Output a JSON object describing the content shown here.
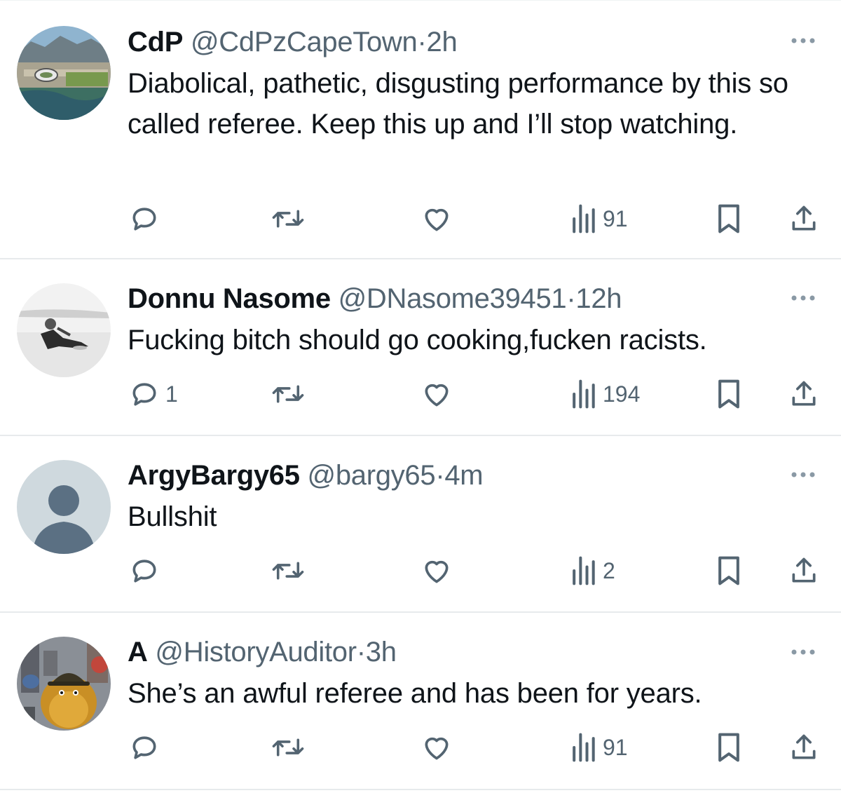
{
  "tweets": [
    {
      "name": "CdP",
      "handle": "@CdPzCapeTown",
      "separator": "·",
      "time": "2h",
      "text": "Diabolical, pathetic, disgusting performance by this so called referee. Keep this up and I’ll stop watching.",
      "reply_count": "",
      "views": "91"
    },
    {
      "name": "Donnu Nasome",
      "handle": "@DNasome39451",
      "separator": "·",
      "time": "12h",
      "text": "Fucking bitch should go cooking,fucken racists.",
      "reply_count": "1",
      "views": "194"
    },
    {
      "name": "ArgyBargy65",
      "handle": "@bargy65",
      "separator": "·",
      "time": "4m",
      "text": "Bullshit",
      "reply_count": "",
      "views": "2"
    },
    {
      "name": "A",
      "handle": "@HistoryAuditor",
      "separator": "·",
      "time": "3h",
      "text": "She’s an awful referee and has been for years.",
      "reply_count": "",
      "views": "91"
    }
  ],
  "icons": {
    "more": "more-horizontal-icon",
    "reply": "reply-bubble-icon",
    "retweet": "retweet-icon",
    "like": "heart-icon",
    "views": "analytics-bars-icon",
    "bookmark": "bookmark-icon",
    "share": "share-upload-icon"
  },
  "colors": {
    "text": "#0f1419",
    "secondary": "#536471",
    "divider": "#e7eaec",
    "default_avatar_bg": "#cfd9de",
    "default_avatar_fg": "#5b7083"
  }
}
